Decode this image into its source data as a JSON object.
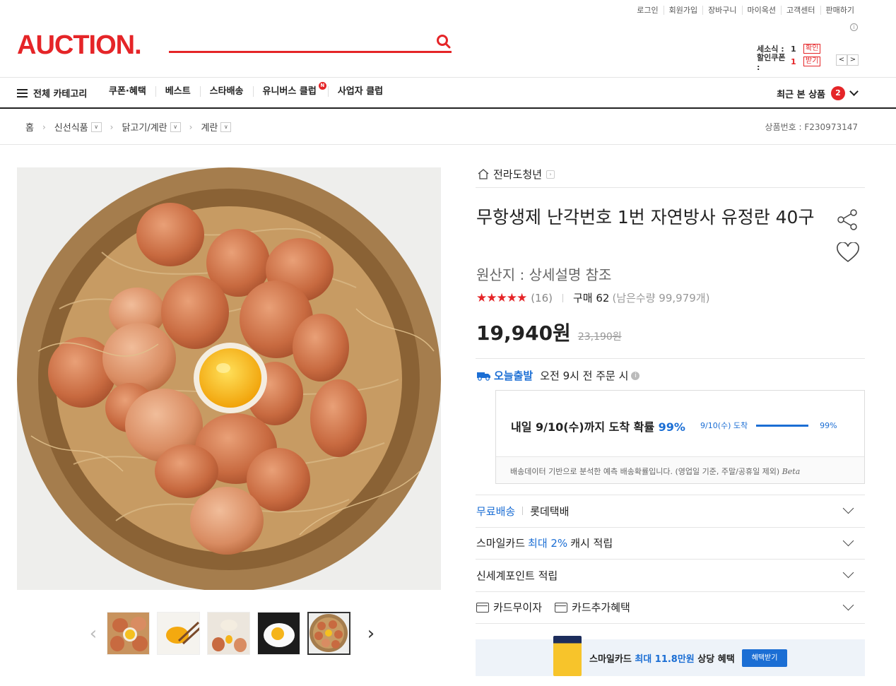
{
  "header": {
    "util_links": [
      "로그인",
      "회원가입",
      "장바구니",
      "마이옥션",
      "고객센터",
      "판매하기"
    ],
    "logo": "AUCTION.",
    "coupon": {
      "sesoksik_label": "세소식 :",
      "sesoksik_value": "1",
      "sesoksik_btn": "확인",
      "discount_label": "할인쿠폰 :",
      "discount_value": "1",
      "discount_btn": "받기"
    },
    "pager_prev": "<",
    "pager_next": ">"
  },
  "gnb": {
    "category": "전체 카테고리",
    "menu": [
      "쿠폰·혜택",
      "베스트",
      "스타배송",
      "유니버스 클럽",
      "사업자 클럽"
    ],
    "new_badge": "N",
    "recent_label": "최근 본 상품",
    "recent_count": "2"
  },
  "breadcrumb": {
    "home": "홈",
    "items": [
      "신선식품",
      "닭고기/계란",
      "계란"
    ],
    "product_no": "상품번호 : F230973147"
  },
  "product": {
    "seller": "전라도청년",
    "title": "무항생제 난각번호 1번 자연방사 유정란 40구",
    "origin": "원산지 : 상세설명 참조",
    "stars": "★★★★★",
    "review_count": "(16)",
    "purchase": "구매 62",
    "remain": "(남은수량 99,979개)",
    "price": "19,940원",
    "orig_price": "23,190원"
  },
  "shipping": {
    "today_label": "오늘출발",
    "today_desc": "오전 9시 전 주문 시",
    "arrival_text": "내일 9/10(수)까지 도착 확률 ",
    "arrival_pct": "99%",
    "mini_label": "9/10(수) 도착",
    "mini_pct": "99%",
    "arrival_probability": 0.99,
    "note": "배송데이터 기반으로 분석한 예측 배송확률입니다. (영업일 기준, 주말/공휴일 제외) ",
    "beta": "Beta"
  },
  "rows": {
    "free_ship": "무료배송",
    "courier": "롯데택배",
    "smile_a": "스마일카드 ",
    "smile_b": "최대 2%",
    "smile_c": " 캐시 적립",
    "shinsegae": "신세계포인트 적립",
    "card_interest": "카드무이자",
    "card_benefit": "카드추가혜택"
  },
  "banner": {
    "t1": "스마일카드 ",
    "t2": "최대 11.8만원",
    "t3": " 상당 혜택",
    "btn": "혜택받기"
  },
  "colors": {
    "brand": "#e52528",
    "accent": "#1b6ed4"
  }
}
